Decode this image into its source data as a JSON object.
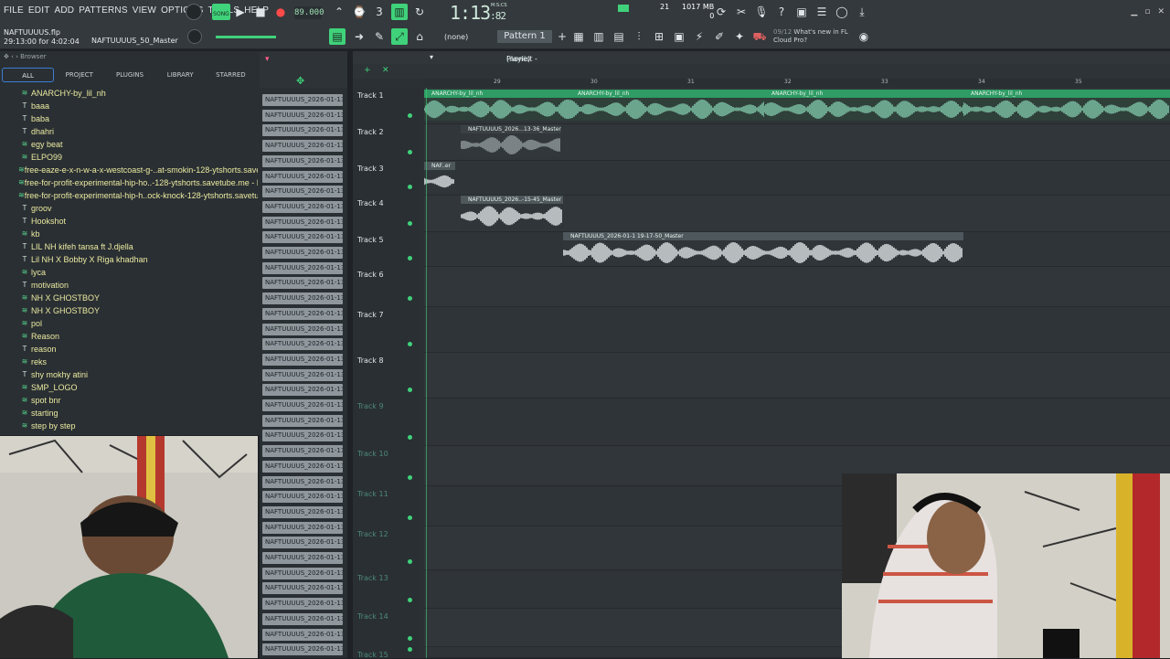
{
  "menu": [
    "FILE",
    "EDIT",
    "ADD",
    "PATTERNS",
    "VIEW",
    "OPTIONS",
    "TOOLS",
    "HELP"
  ],
  "file": {
    "name": "NAFTUUUUS.flp",
    "time": "29:13:00 for 4:02:04",
    "master": "NAFTUUUUS_50_Master"
  },
  "transport": {
    "mode": "SONG",
    "bpm": "89.000",
    "time_main": "1:13",
    "time_small": ":82",
    "time_label": "M:S:CS",
    "cpu": "21",
    "mem": "1017 MB",
    "mem2": "0"
  },
  "pattern": {
    "label": "Pattern 1",
    "none": "(none)"
  },
  "news": {
    "date": "09/12",
    "line1": "What's new in FL",
    "line2": "Cloud Pro?"
  },
  "browser": {
    "title": "Browser",
    "tabs": [
      "ALL",
      "PROJECT",
      "PLUGINS",
      "LIBRARY",
      "STARRED"
    ],
    "items": [
      {
        "label": "ANARCHY-by_lil_nh",
        "icon": "wave"
      },
      {
        "label": "baaa",
        "icon": "text"
      },
      {
        "label": "baba",
        "icon": "text"
      },
      {
        "label": "dhahri",
        "icon": "text"
      },
      {
        "label": "egy beat",
        "icon": "wave"
      },
      {
        "label": "ELPO99",
        "icon": "wave"
      },
      {
        "label": "free-eaze-e-x-n-w-a-x-westcoast-g-..at-smokin-128-ytshorts.savetube.me",
        "icon": "wave"
      },
      {
        "label": "free-for-profit-experimental-hip-ho..-128-ytshorts.savetube.me - Part_2",
        "icon": "wave"
      },
      {
        "label": "free-for-profit-experimental-hip-h..ock-knock-128-ytshorts.savetube.me",
        "icon": "wave"
      },
      {
        "label": "groov",
        "icon": "text"
      },
      {
        "label": "Hookshot",
        "icon": "text"
      },
      {
        "label": "kb",
        "icon": "wave"
      },
      {
        "label": "LIL NH kifeh tansa ft J.djella",
        "icon": "text"
      },
      {
        "label": "Lil NH X Bobby X Riga khadhan",
        "icon": "text"
      },
      {
        "label": "lyca",
        "icon": "wave"
      },
      {
        "label": "motivation",
        "icon": "text"
      },
      {
        "label": "NH X GHOSTBOY",
        "icon": "wave"
      },
      {
        "label": "NH X GHOSTBOY",
        "icon": "wave"
      },
      {
        "label": "pol",
        "icon": "wave"
      },
      {
        "label": "Reason",
        "icon": "wave"
      },
      {
        "label": "reason",
        "icon": "text"
      },
      {
        "label": "reks",
        "icon": "wave"
      },
      {
        "label": "shy mokhy atini",
        "icon": "text"
      },
      {
        "label": "SMP_LOGO",
        "icon": "wave"
      },
      {
        "label": "spot bnr",
        "icon": "wave"
      },
      {
        "label": "starting",
        "icon": "wave"
      },
      {
        "label": "step by step",
        "icon": "wave"
      }
    ]
  },
  "channels": {
    "label": "NAFTUUUUS_2026-01-13...",
    "count": 37
  },
  "playlist": {
    "title": "Playlist - Arrangement",
    "none": "(none)",
    "ruler": [
      "29",
      "30",
      "31",
      "32",
      "33",
      "34",
      "35"
    ],
    "tracks": [
      "Track 1",
      "Track 2",
      "Track 3",
      "Track 4",
      "Track 5",
      "Track 6",
      "Track 7",
      "Track 8",
      "Track 9",
      "Track 10",
      "Track 11",
      "Track 12",
      "Track 13",
      "Track 14",
      "Track 15"
    ],
    "clips": [
      {
        "name": "ANARCHY-by_lil_nh"
      },
      {
        "name": "ANARCHY-by_lil_nh"
      },
      {
        "name": "ANARCHY-by_lil_nh"
      },
      {
        "name": "ANARCHY-by_lil_nh"
      },
      {
        "name": "NAFTUUUUS_2026...13-36_Master"
      },
      {
        "name": "NAF..er"
      },
      {
        "name": "NAFTUUUUS_2026..-15-45_Master"
      },
      {
        "name": "NAFTUUUUS_2026-01-1 19-17-50_Master"
      }
    ]
  },
  "colors": {
    "accent": "#3fd27a",
    "clip_green": "#2fa86a",
    "clip_gray": "#9aa3a8"
  }
}
